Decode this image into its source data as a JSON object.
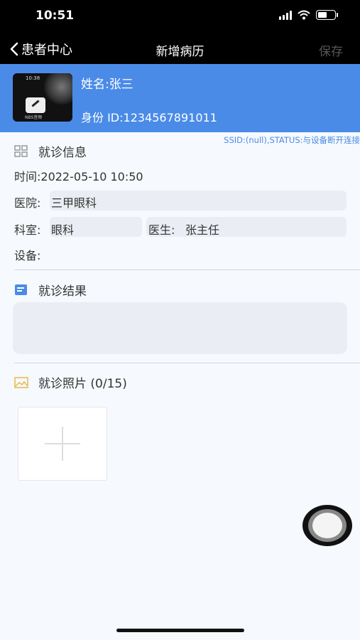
{
  "status_bar": {
    "time": "10:51"
  },
  "nav": {
    "back_label": "患者中心",
    "title": "新增病历",
    "save_label": "保存"
  },
  "patient": {
    "name": "姓名:张三",
    "id": "身份 ID:1234567891011",
    "thumb_time": "10:38",
    "thumb_caption": "NBS音频",
    "connection_status": "SSID:(null),STATUS:与设备断开连接"
  },
  "visit_info": {
    "title": "就诊信息",
    "time": "时间:2022-05-10 10:50",
    "hospital_label": "医院:",
    "hospital_value": "三甲眼科",
    "department_label": "科室:",
    "department_value": "眼科",
    "doctor_label": "医生:",
    "doctor_value": "张主任",
    "device_label": "设备:"
  },
  "visit_result": {
    "title": "就诊结果",
    "value": ""
  },
  "visit_photos": {
    "title": "就诊照片 (0/15)"
  }
}
